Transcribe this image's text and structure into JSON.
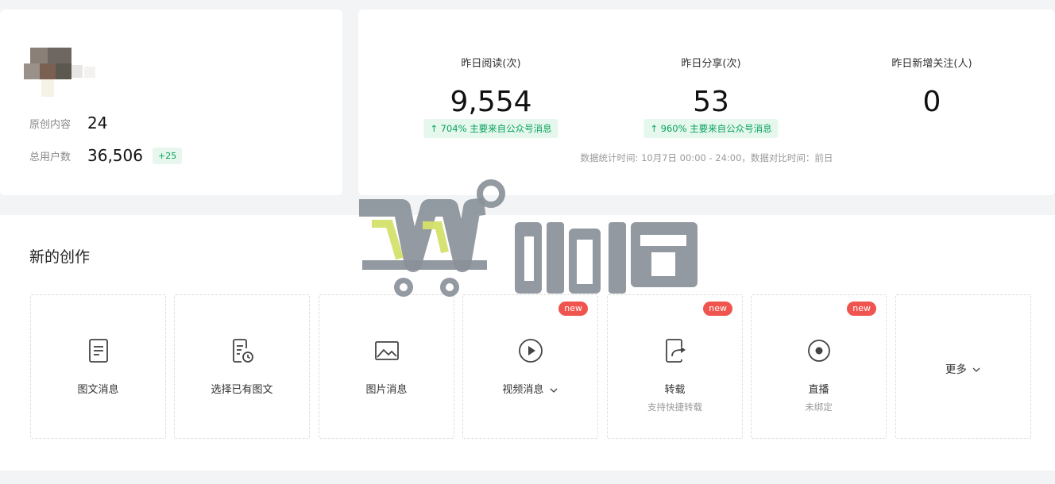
{
  "account": {
    "original_label": "原创内容",
    "original_value": "24",
    "users_label": "总用户数",
    "users_value": "36,506",
    "users_delta": "+25"
  },
  "stats": {
    "items": [
      {
        "label": "昨日阅读(次)",
        "value": "9,554",
        "trend": "↑ 704%  主要来自公众号消息"
      },
      {
        "label": "昨日分享(次)",
        "value": "53",
        "trend": "↑ 960%  主要来自公众号消息"
      },
      {
        "label": "昨日新增关注(人)",
        "value": "0"
      }
    ],
    "footnote": "数据统计时间: 10月7日 00:00 - 24:00，数据对比时间：前日"
  },
  "create": {
    "title": "新的创作",
    "tiles": [
      {
        "label": "图文消息",
        "icon": "document-icon"
      },
      {
        "label": "选择已有图文",
        "icon": "document-clock-icon"
      },
      {
        "label": "图片消息",
        "icon": "image-icon"
      },
      {
        "label": "视频消息",
        "icon": "play-circle-icon",
        "badge": "new"
      },
      {
        "label": "转载",
        "sub": "支持快捷转载",
        "icon": "share-icon",
        "badge": "new"
      },
      {
        "label": "直播",
        "sub": "未绑定",
        "icon": "live-icon",
        "badge": "new"
      },
      {
        "label": "更多",
        "icon": "chevron-down-icon"
      }
    ]
  },
  "colors": {
    "accent_green": "#07a35a",
    "badge_red": "#f0544f",
    "watermark_gray": "#8a9199",
    "watermark_yellow": "#d4e06a"
  }
}
